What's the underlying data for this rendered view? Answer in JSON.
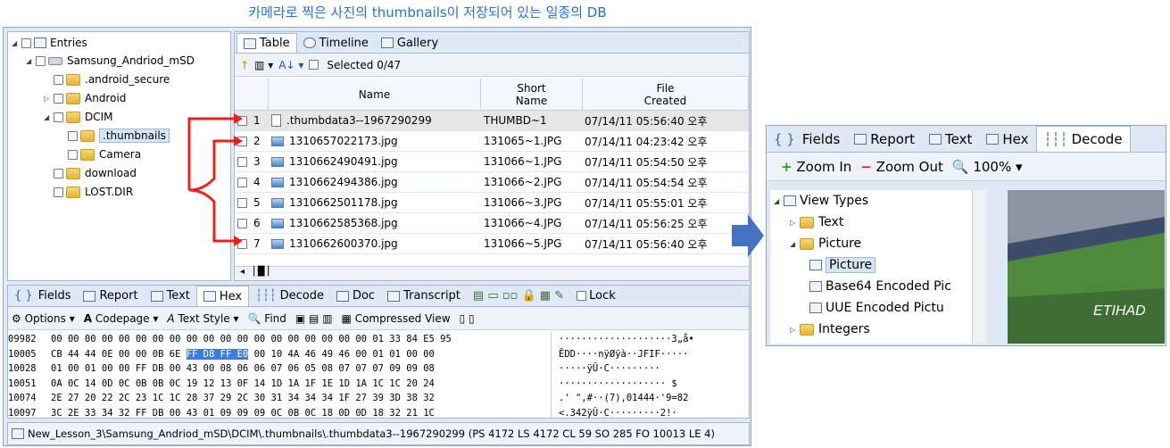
{
  "caption": "카메라로 찍은 사진의 thumbnails이 저장되어 있는 일종의 DB",
  "tree": {
    "items": [
      "Entries",
      "Samsung_Andriod_mSD",
      ".android_secure",
      "Android",
      "DCIM",
      ".thumbnails",
      "Camera",
      "download",
      "LOST.DIR"
    ]
  },
  "main_tabs": [
    "Table",
    "Timeline",
    "Gallery"
  ],
  "toolbar": {
    "selected": "Selected 0/47"
  },
  "grid": {
    "headers": [
      "Name",
      "Short\nName",
      "File\nCreated"
    ],
    "rows": [
      {
        "n": "1",
        "name": ".thumbdata3--1967290299",
        "short": "THUMBD~1",
        "created": "07/14/11 05:56:40 오후"
      },
      {
        "n": "2",
        "name": "1310657022173.jpg",
        "short": "131065~1.JPG",
        "created": "07/14/11 04:23:42 오후"
      },
      {
        "n": "3",
        "name": "1310662490491.jpg",
        "short": "131066~1.JPG",
        "created": "07/14/11 05:54:50 오후"
      },
      {
        "n": "4",
        "name": "1310662494386.jpg",
        "short": "131066~2.JPG",
        "created": "07/14/11 05:54:54 오후"
      },
      {
        "n": "5",
        "name": "1310662501178.jpg",
        "short": "131066~3.JPG",
        "created": "07/14/11 05:55:01 오후"
      },
      {
        "n": "6",
        "name": "1310662585368.jpg",
        "short": "131066~4.JPG",
        "created": "07/14/11 05:56:25 오후"
      },
      {
        "n": "7",
        "name": "1310662600370.jpg",
        "short": "131066~5.JPG",
        "created": "07/14/11 05:56:40 오후"
      }
    ]
  },
  "bottom_tabs": [
    "Fields",
    "Report",
    "Text",
    "Hex",
    "Decode",
    "Doc",
    "Transcript",
    "Lock"
  ],
  "hex_toolbar": [
    "Options",
    "Codepage",
    "Text Style",
    "Find",
    "Compressed View"
  ],
  "hex": [
    {
      "off": "09982",
      "b1": "00 00 00 00 00 00 00 00 00 00 00 00 00 00 00 00 00 00 00 01 33 84 E5 95",
      "hl": "",
      "b2": "",
      "asc": "····················3„å•"
    },
    {
      "off": "10005",
      "b1": "CB 44 44 0E 00 00 0B 6E ",
      "hl": "FF D8 FF E0",
      "b2": " 00 10 4A 46 49 46 00 01 01 00 00",
      "asc": "ËDD····nÿØÿà··JFIF·····"
    },
    {
      "off": "10028",
      "b1": "01 00 01 00 00 FF DB 00 43 00 08 06 06 07 06 05 08 07 07 07 09 09 08",
      "hl": "",
      "b2": "",
      "asc": "·····ÿÛ·C·········"
    },
    {
      "off": "10051",
      "b1": "0A 0C 14 0D 0C 0B 0B 0C 19 12 13 0F 14 1D 1A 1F 1E 1D 1A 1C 1C 20 24",
      "hl": "",
      "b2": "",
      "asc": "··················· $"
    },
    {
      "off": "10074",
      "b1": "2E 27 20 22 2C 23 1C 1C 28 37 29 2C 30 31 34 34 34 1F 27 39 3D 38 32",
      "hl": "",
      "b2": "",
      "asc": ".' \",#··(7),01444·'9=82"
    },
    {
      "off": "10097",
      "b1": "3C 2E 33 34 32 FF DB 00 43 01 09 09 09 0C 0B 0C 18 0D 0D 18 32 21 1C",
      "hl": "",
      "b2": "",
      "asc": "<.342ÿÛ·C·········2!·"
    }
  ],
  "status": "New_Lesson_3\\Samsung_Andriod_mSD\\DCIM\\.thumbnails\\.thumbdata3--1967290299 (PS 4172 LS 4172 CL 59 SO 285 FO 10013 LE 4)",
  "decode_panel": {
    "tabs": [
      "Fields",
      "Report",
      "Text",
      "Hex",
      "Decode"
    ],
    "zoom_in": "Zoom In",
    "zoom_out": "Zoom Out",
    "zoom_level": "100%",
    "tree": [
      "View Types",
      "Text",
      "Picture",
      "Picture",
      "Base64 Encoded Pic",
      "UUE Encoded Pictu",
      "Integers"
    ],
    "photo_text": "ETIHAD"
  },
  "colors": {
    "arrow": "#e8231c",
    "blue_arrow": "#4472c4",
    "caption": "#2a6fd1",
    "selection": "#3d7ddc"
  }
}
